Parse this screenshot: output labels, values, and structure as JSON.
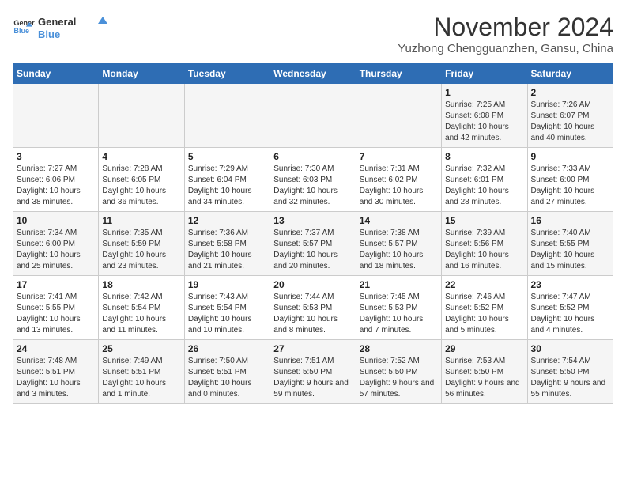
{
  "logo": {
    "line1": "General",
    "line2": "Blue"
  },
  "title": "November 2024",
  "subtitle": "Yuzhong Chengguanzhen, Gansu, China",
  "weekdays": [
    "Sunday",
    "Monday",
    "Tuesday",
    "Wednesday",
    "Thursday",
    "Friday",
    "Saturday"
  ],
  "weeks": [
    [
      {
        "day": "",
        "info": ""
      },
      {
        "day": "",
        "info": ""
      },
      {
        "day": "",
        "info": ""
      },
      {
        "day": "",
        "info": ""
      },
      {
        "day": "",
        "info": ""
      },
      {
        "day": "1",
        "info": "Sunrise: 7:25 AM\nSunset: 6:08 PM\nDaylight: 10 hours and 42 minutes."
      },
      {
        "day": "2",
        "info": "Sunrise: 7:26 AM\nSunset: 6:07 PM\nDaylight: 10 hours and 40 minutes."
      }
    ],
    [
      {
        "day": "3",
        "info": "Sunrise: 7:27 AM\nSunset: 6:06 PM\nDaylight: 10 hours and 38 minutes."
      },
      {
        "day": "4",
        "info": "Sunrise: 7:28 AM\nSunset: 6:05 PM\nDaylight: 10 hours and 36 minutes."
      },
      {
        "day": "5",
        "info": "Sunrise: 7:29 AM\nSunset: 6:04 PM\nDaylight: 10 hours and 34 minutes."
      },
      {
        "day": "6",
        "info": "Sunrise: 7:30 AM\nSunset: 6:03 PM\nDaylight: 10 hours and 32 minutes."
      },
      {
        "day": "7",
        "info": "Sunrise: 7:31 AM\nSunset: 6:02 PM\nDaylight: 10 hours and 30 minutes."
      },
      {
        "day": "8",
        "info": "Sunrise: 7:32 AM\nSunset: 6:01 PM\nDaylight: 10 hours and 28 minutes."
      },
      {
        "day": "9",
        "info": "Sunrise: 7:33 AM\nSunset: 6:00 PM\nDaylight: 10 hours and 27 minutes."
      }
    ],
    [
      {
        "day": "10",
        "info": "Sunrise: 7:34 AM\nSunset: 6:00 PM\nDaylight: 10 hours and 25 minutes."
      },
      {
        "day": "11",
        "info": "Sunrise: 7:35 AM\nSunset: 5:59 PM\nDaylight: 10 hours and 23 minutes."
      },
      {
        "day": "12",
        "info": "Sunrise: 7:36 AM\nSunset: 5:58 PM\nDaylight: 10 hours and 21 minutes."
      },
      {
        "day": "13",
        "info": "Sunrise: 7:37 AM\nSunset: 5:57 PM\nDaylight: 10 hours and 20 minutes."
      },
      {
        "day": "14",
        "info": "Sunrise: 7:38 AM\nSunset: 5:57 PM\nDaylight: 10 hours and 18 minutes."
      },
      {
        "day": "15",
        "info": "Sunrise: 7:39 AM\nSunset: 5:56 PM\nDaylight: 10 hours and 16 minutes."
      },
      {
        "day": "16",
        "info": "Sunrise: 7:40 AM\nSunset: 5:55 PM\nDaylight: 10 hours and 15 minutes."
      }
    ],
    [
      {
        "day": "17",
        "info": "Sunrise: 7:41 AM\nSunset: 5:55 PM\nDaylight: 10 hours and 13 minutes."
      },
      {
        "day": "18",
        "info": "Sunrise: 7:42 AM\nSunset: 5:54 PM\nDaylight: 10 hours and 11 minutes."
      },
      {
        "day": "19",
        "info": "Sunrise: 7:43 AM\nSunset: 5:54 PM\nDaylight: 10 hours and 10 minutes."
      },
      {
        "day": "20",
        "info": "Sunrise: 7:44 AM\nSunset: 5:53 PM\nDaylight: 10 hours and 8 minutes."
      },
      {
        "day": "21",
        "info": "Sunrise: 7:45 AM\nSunset: 5:53 PM\nDaylight: 10 hours and 7 minutes."
      },
      {
        "day": "22",
        "info": "Sunrise: 7:46 AM\nSunset: 5:52 PM\nDaylight: 10 hours and 5 minutes."
      },
      {
        "day": "23",
        "info": "Sunrise: 7:47 AM\nSunset: 5:52 PM\nDaylight: 10 hours and 4 minutes."
      }
    ],
    [
      {
        "day": "24",
        "info": "Sunrise: 7:48 AM\nSunset: 5:51 PM\nDaylight: 10 hours and 3 minutes."
      },
      {
        "day": "25",
        "info": "Sunrise: 7:49 AM\nSunset: 5:51 PM\nDaylight: 10 hours and 1 minute."
      },
      {
        "day": "26",
        "info": "Sunrise: 7:50 AM\nSunset: 5:51 PM\nDaylight: 10 hours and 0 minutes."
      },
      {
        "day": "27",
        "info": "Sunrise: 7:51 AM\nSunset: 5:50 PM\nDaylight: 9 hours and 59 minutes."
      },
      {
        "day": "28",
        "info": "Sunrise: 7:52 AM\nSunset: 5:50 PM\nDaylight: 9 hours and 57 minutes."
      },
      {
        "day": "29",
        "info": "Sunrise: 7:53 AM\nSunset: 5:50 PM\nDaylight: 9 hours and 56 minutes."
      },
      {
        "day": "30",
        "info": "Sunrise: 7:54 AM\nSunset: 5:50 PM\nDaylight: 9 hours and 55 minutes."
      }
    ]
  ]
}
